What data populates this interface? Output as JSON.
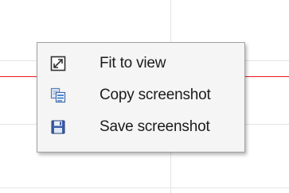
{
  "context_menu": {
    "items": [
      {
        "label": "Fit to view",
        "icon": "fit-to-view-icon"
      },
      {
        "label": "Copy screenshot",
        "icon": "copy-icon"
      },
      {
        "label": "Save screenshot",
        "icon": "save-disk-icon"
      }
    ]
  },
  "colors": {
    "series_line": "#e8171b",
    "gridline": "#e4e4e4",
    "menu_background": "#f5f5f5",
    "menu_border": "#a0a0a0",
    "save_icon_blue": "#3d5ea8"
  }
}
